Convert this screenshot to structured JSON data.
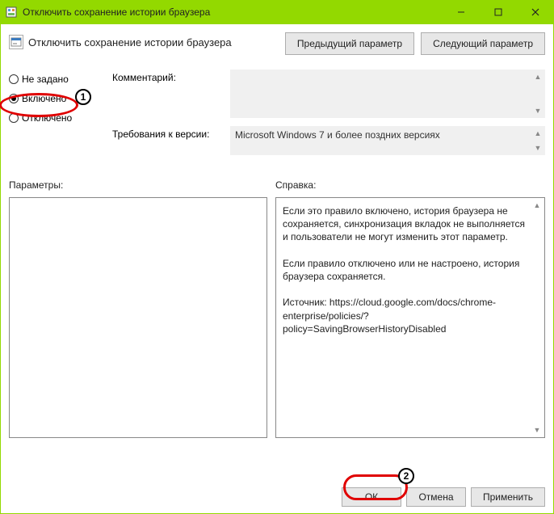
{
  "window": {
    "title": "Отключить сохранение истории браузера"
  },
  "header": {
    "title": "Отключить сохранение истории браузера",
    "prev_btn": "Предыдущий параметр",
    "next_btn": "Следующий параметр"
  },
  "radios": {
    "not_set": "Не задано",
    "enabled": "Включено",
    "disabled": "Отключено",
    "selected": "enabled"
  },
  "fields": {
    "comment_label": "Комментарий:",
    "comment_value": "",
    "req_label": "Требования к версии:",
    "req_value": "Microsoft Windows 7 и более поздних версиях"
  },
  "sections": {
    "params_label": "Параметры:",
    "help_label": "Справка:"
  },
  "help_text": "Если это правило включено, история браузера не сохраняется, синхронизация вкладок не выполняется и пользователи не могут изменить этот параметр.\n\nЕсли правило отключено или не настроено, история браузера сохраняется.\n\nИсточник: https://cloud.google.com/docs/chrome-enterprise/policies/?policy=SavingBrowserHistoryDisabled",
  "buttons": {
    "ok": "ОК",
    "cancel": "Отмена",
    "apply": "Применить"
  },
  "annotations": {
    "a1": "1",
    "a2": "2"
  }
}
